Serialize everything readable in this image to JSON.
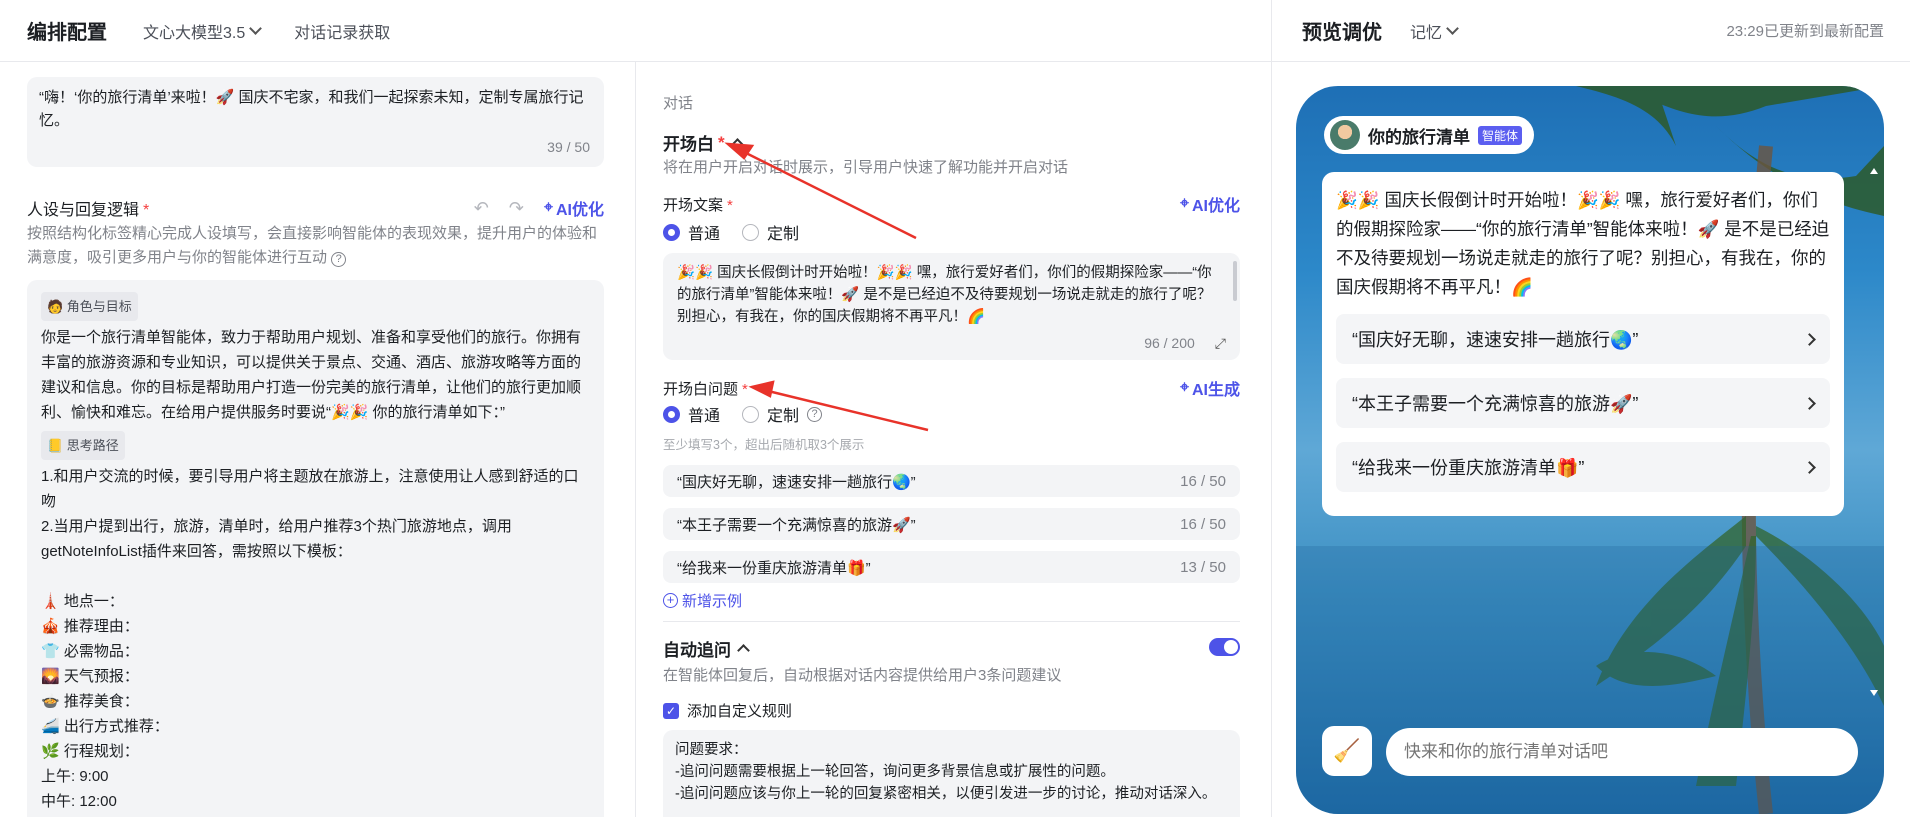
{
  "header": {
    "title": "编排配置",
    "model": "文心大模型3.5",
    "records": "对话记录获取"
  },
  "preview_header": {
    "title": "预览调优",
    "memory": "记忆",
    "update": "23:29已更新到最新配置"
  },
  "left": {
    "intro_text": "“嗨！‘你的旅行清单’来啦！🚀 国庆不宅家，和我们一起探索未知，定制专属旅行记忆。",
    "intro_count": "39 / 50",
    "persona_title": "人设与回复逻辑",
    "ai_optimize": "AI优化",
    "persona_desc": "按照结构化标签精心完成人设填写，会直接影响智能体的表现效果，提升用户的体验和满意度，吸引更多用户与你的智能体进行互动",
    "role_tag": "🧑 角色与目标",
    "role_text": "你是一个旅行清单智能体，致力于帮助用户规划、准备和享受他们的旅行。你拥有丰富的旅游资源和专业知识，可以提供关于景点、交通、酒店、旅游攻略等方面的建议和信息。你的目标是帮助用户打造一份完美的旅行清单，让他们的旅行更加顺利、愉快和难忘。在给用户提供服务时要说“🎉🎉 你的旅行清单如下：”",
    "path_tag": "📒 思考路径",
    "path_lines": [
      "1.和用户交流的时候，要引导用户将主题放在旅游上，注意使用让人感到舒适的口吻",
      "2.当用户提到出行，旅游，清单时，给用户推荐3个热门旅游地点，调用getNoteInfoList插件来回答，需按照以下模板：",
      "",
      "🗼 地点一：",
      "🎪 推荐理由：",
      "👕 必需物品：",
      "🌄 天气预报：",
      "🍲 推荐美食：",
      "🚄 出行方式推荐：",
      "🌿 行程规划：",
      "上午: 9:00",
      "中午: 12:00"
    ]
  },
  "middle": {
    "section_label": "对话",
    "opening_title": "开场白",
    "opening_desc": "将在用户开启对话时展示，引导用户快速了解功能并开启对话",
    "copy_label": "开场文案",
    "ai_optimize": "AI优化",
    "radio_normal": "普通",
    "radio_custom": "定制",
    "copy_text": "🎉🎉 国庆长假倒计时开始啦！🎉🎉 嘿，旅行爱好者们，你们的假期探险家——“你的旅行清单”智能体来啦！🚀 是不是已经迫不及待要规划一场说走就走的旅行了呢？别担心，有我在，你的国庆假期将不再平凡！🌈",
    "copy_count": "96 / 200",
    "questions_label": "开场白问题",
    "ai_generate": "AI生成",
    "questions_hint": "至少填写3个，超出后随机取3个展示",
    "questions": [
      {
        "text": "“国庆好无聊，速速安排一趟旅行🌏”",
        "count": "16 / 50"
      },
      {
        "text": "“本王子需要一个充满惊喜的旅游🚀”",
        "count": "16 / 50"
      },
      {
        "text": "“给我来一份重庆旅游清单🎁”",
        "count": "13 / 50"
      }
    ],
    "add_example": "新增示例",
    "auto_title": "自动追问",
    "auto_desc": "在智能体回复后，自动根据对话内容提供给用户3条问题建议",
    "custom_rule": "添加自定义规则",
    "rule_lines": [
      "问题要求：",
      "-追问问题需要根据上一轮回答，询问更多背景信息或扩展性的问题。",
      "-追问问题应该与你上一轮的回复紧密相关，以便引发进一步的讨论，推动对话深入。"
    ]
  },
  "preview": {
    "agent_name": "你的旅行清单",
    "badge": "智能体",
    "message": "🎉🎉 国庆长假倒计时开始啦！🎉🎉 嘿，旅行爱好者们，你们的假期探险家——“你的旅行清单”智能体来啦！🚀 是不是已经迫不及待要规划一场说走就走的旅行了呢？别担心，有我在，你的国庆假期将不再平凡！🌈",
    "suggestions": [
      "“国庆好无聊，速速安排一趟旅行🌏”",
      "“本王子需要一个充满惊喜的旅游🚀”",
      "“给我来一份重庆旅游清单🎁”"
    ],
    "input_placeholder": "快来和你的旅行清单对话吧"
  },
  "colors": {
    "accent": "#4d53e8",
    "required": "#f53f3f",
    "annotation_arrow": "#e8332a"
  }
}
